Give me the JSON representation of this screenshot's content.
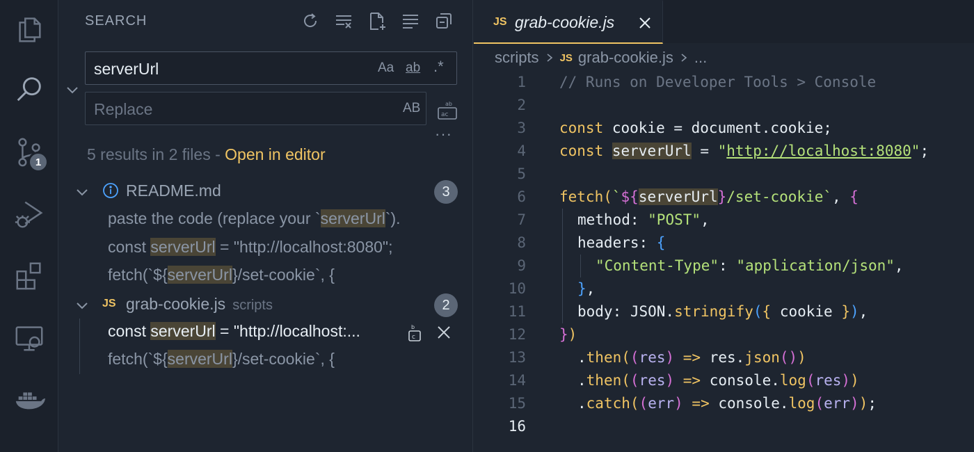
{
  "activity_bar": {
    "items": [
      {
        "icon": "files-icon"
      },
      {
        "icon": "search-icon"
      },
      {
        "icon": "source-control-icon",
        "badge": "1"
      },
      {
        "icon": "run-debug-icon"
      },
      {
        "icon": "extensions-icon"
      },
      {
        "icon": "remote-explorer-icon"
      },
      {
        "icon": "docker-icon"
      }
    ]
  },
  "search_panel": {
    "title": "SEARCH",
    "search": {
      "value": "serverUrl",
      "opt_case": "Aa",
      "opt_word": "ab",
      "opt_regex": ".*"
    },
    "replace": {
      "placeholder": "Replace",
      "opt_preserve": "AB"
    },
    "more": "···",
    "summary": "5 results in 2 files - ",
    "open_in_editor": "Open in editor",
    "files": [
      {
        "name": "README.md",
        "path": "",
        "count": "3",
        "matches": [
          {
            "pre": "paste the code (replace your `",
            "hit": "serverUrl",
            "post": "`)."
          },
          {
            "pre": "const ",
            "hit": "serverUrl",
            "post": " = \"http://localhost:8080\";"
          },
          {
            "pre": "fetch(`${",
            "hit": "serverUrl",
            "post": "}/set-cookie`, {"
          }
        ]
      },
      {
        "name": "grab-cookie.js",
        "path": "scripts",
        "count": "2",
        "matches": [
          {
            "pre": "const ",
            "hit": "serverUrl",
            "post": " = \"http://localhost:..."
          },
          {
            "pre": "fetch(`${",
            "hit": "serverUrl",
            "post": "}/set-cookie`, {"
          }
        ]
      }
    ]
  },
  "editor": {
    "tab": {
      "lang": "JS",
      "name": "grab-cookie.js"
    },
    "breadcrumb": {
      "folder": "scripts",
      "lang": "JS",
      "file": "grab-cookie.js",
      "more": "..."
    },
    "line_numbers": [
      "1",
      "2",
      "3",
      "4",
      "5",
      "6",
      "7",
      "8",
      "9",
      "10",
      "11",
      "12",
      "13",
      "14",
      "15",
      "16"
    ],
    "current_line": "16",
    "code": {
      "l1": "// Runs on Developer Tools > Console",
      "l3_kw": "const",
      "l3_rest": " cookie = document.cookie;",
      "l4_kw": "const",
      "l4_var": "serverUrl",
      "l4_eq": " = ",
      "l4_q1": "\"",
      "l4_url": "http://localhost:8080",
      "l4_q2": "\"",
      "l4_end": ";",
      "l6_fn": "fetch",
      "l6_p": "(",
      "l6_s1": "`",
      "l6_t1": "${",
      "l6_var": "serverUrl",
      "l6_t2": "}",
      "l6_s2": "/set-cookie`",
      "l6_c": ", ",
      "l6_b": "{",
      "l7_key": "method: ",
      "l7_val": "\"POST\"",
      "l7_end": ",",
      "l8_key": "headers: ",
      "l8_b": "{",
      "l9_key": "\"Content-Type\"",
      "l9_c": ": ",
      "l9_val": "\"application/json\"",
      "l9_end": ",",
      "l10_b": "}",
      "l10_end": ",",
      "l11_key": "body: JSON.",
      "l11_fn": "stringify",
      "l11_p1": "(",
      "l11_b1": "{",
      "l11_mid": " cookie ",
      "l11_b2": "}",
      "l11_p2": ")",
      "l11_end": ",",
      "l12_b": "}",
      "l12_p": ")",
      "l13_dot": ".",
      "l13_fn": "then",
      "l13_p1": "(",
      "l13_p2": "(",
      "l13_arg": "res",
      "l13_p3": ")",
      "l13_arrow": " => ",
      "l13_obj": "res.",
      "l13_fn2": "json",
      "l13_p4": "()",
      "l13_p5": ")",
      "l14_dot": ".",
      "l14_fn": "then",
      "l14_p1": "(",
      "l14_p2": "(",
      "l14_arg": "res",
      "l14_p3": ")",
      "l14_arrow": " => ",
      "l14_obj": "console.",
      "l14_fn2": "log",
      "l14_p4": "(",
      "l14_arg2": "res",
      "l14_p5": ")",
      "l14_p6": ")",
      "l15_dot": ".",
      "l15_fn": "catch",
      "l15_p1": "(",
      "l15_p2": "(",
      "l15_arg": "err",
      "l15_p3": ")",
      "l15_arrow": " => ",
      "l15_obj": "console.",
      "l15_fn2": "log",
      "l15_p4": "(",
      "l15_arg2": "err",
      "l15_p5": ")",
      "l15_p6": ")",
      "l15_end": ";"
    }
  },
  "colors": {
    "accent": "#f0c463",
    "background": "#1e2530",
    "highlight": "#4a4536",
    "string": "#b5e27a"
  }
}
